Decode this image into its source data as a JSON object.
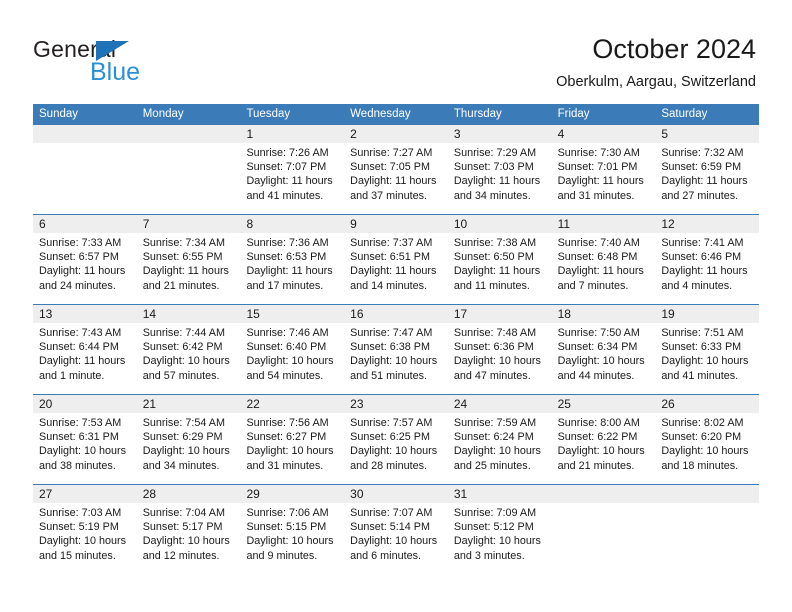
{
  "logo": {
    "text_primary": "General",
    "text_secondary": "Blue",
    "triangle_icon": "triangle-icon",
    "color_primary": "#231f20",
    "color_secondary": "#2b8fd6",
    "color_triangle": "#1e72b8"
  },
  "header": {
    "title": "October 2024",
    "subtitle": "Oberkulm, Aargau, Switzerland"
  },
  "theme": {
    "header_row_bg": "#3b7cb8",
    "date_band_bg": "#eeeeee",
    "separator": "#3b7cb8",
    "text": "#1a1a1a"
  },
  "weekdays": [
    "Sunday",
    "Monday",
    "Tuesday",
    "Wednesday",
    "Thursday",
    "Friday",
    "Saturday"
  ],
  "weeks": [
    {
      "days": [
        {
          "date": "",
          "sunrise": "",
          "sunset": "",
          "daylight_line1": "",
          "daylight_line2": "",
          "empty": true
        },
        {
          "date": "",
          "sunrise": "",
          "sunset": "",
          "daylight_line1": "",
          "daylight_line2": "",
          "empty": true
        },
        {
          "date": "1",
          "sunrise": "Sunrise: 7:26 AM",
          "sunset": "Sunset: 7:07 PM",
          "daylight_line1": "Daylight: 11 hours",
          "daylight_line2": "and 41 minutes."
        },
        {
          "date": "2",
          "sunrise": "Sunrise: 7:27 AM",
          "sunset": "Sunset: 7:05 PM",
          "daylight_line1": "Daylight: 11 hours",
          "daylight_line2": "and 37 minutes."
        },
        {
          "date": "3",
          "sunrise": "Sunrise: 7:29 AM",
          "sunset": "Sunset: 7:03 PM",
          "daylight_line1": "Daylight: 11 hours",
          "daylight_line2": "and 34 minutes."
        },
        {
          "date": "4",
          "sunrise": "Sunrise: 7:30 AM",
          "sunset": "Sunset: 7:01 PM",
          "daylight_line1": "Daylight: 11 hours",
          "daylight_line2": "and 31 minutes."
        },
        {
          "date": "5",
          "sunrise": "Sunrise: 7:32 AM",
          "sunset": "Sunset: 6:59 PM",
          "daylight_line1": "Daylight: 11 hours",
          "daylight_line2": "and 27 minutes."
        }
      ]
    },
    {
      "days": [
        {
          "date": "6",
          "sunrise": "Sunrise: 7:33 AM",
          "sunset": "Sunset: 6:57 PM",
          "daylight_line1": "Daylight: 11 hours",
          "daylight_line2": "and 24 minutes."
        },
        {
          "date": "7",
          "sunrise": "Sunrise: 7:34 AM",
          "sunset": "Sunset: 6:55 PM",
          "daylight_line1": "Daylight: 11 hours",
          "daylight_line2": "and 21 minutes."
        },
        {
          "date": "8",
          "sunrise": "Sunrise: 7:36 AM",
          "sunset": "Sunset: 6:53 PM",
          "daylight_line1": "Daylight: 11 hours",
          "daylight_line2": "and 17 minutes."
        },
        {
          "date": "9",
          "sunrise": "Sunrise: 7:37 AM",
          "sunset": "Sunset: 6:51 PM",
          "daylight_line1": "Daylight: 11 hours",
          "daylight_line2": "and 14 minutes."
        },
        {
          "date": "10",
          "sunrise": "Sunrise: 7:38 AM",
          "sunset": "Sunset: 6:50 PM",
          "daylight_line1": "Daylight: 11 hours",
          "daylight_line2": "and 11 minutes."
        },
        {
          "date": "11",
          "sunrise": "Sunrise: 7:40 AM",
          "sunset": "Sunset: 6:48 PM",
          "daylight_line1": "Daylight: 11 hours",
          "daylight_line2": "and 7 minutes."
        },
        {
          "date": "12",
          "sunrise": "Sunrise: 7:41 AM",
          "sunset": "Sunset: 6:46 PM",
          "daylight_line1": "Daylight: 11 hours",
          "daylight_line2": "and 4 minutes."
        }
      ]
    },
    {
      "days": [
        {
          "date": "13",
          "sunrise": "Sunrise: 7:43 AM",
          "sunset": "Sunset: 6:44 PM",
          "daylight_line1": "Daylight: 11 hours",
          "daylight_line2": "and 1 minute."
        },
        {
          "date": "14",
          "sunrise": "Sunrise: 7:44 AM",
          "sunset": "Sunset: 6:42 PM",
          "daylight_line1": "Daylight: 10 hours",
          "daylight_line2": "and 57 minutes."
        },
        {
          "date": "15",
          "sunrise": "Sunrise: 7:46 AM",
          "sunset": "Sunset: 6:40 PM",
          "daylight_line1": "Daylight: 10 hours",
          "daylight_line2": "and 54 minutes."
        },
        {
          "date": "16",
          "sunrise": "Sunrise: 7:47 AM",
          "sunset": "Sunset: 6:38 PM",
          "daylight_line1": "Daylight: 10 hours",
          "daylight_line2": "and 51 minutes."
        },
        {
          "date": "17",
          "sunrise": "Sunrise: 7:48 AM",
          "sunset": "Sunset: 6:36 PM",
          "daylight_line1": "Daylight: 10 hours",
          "daylight_line2": "and 47 minutes."
        },
        {
          "date": "18",
          "sunrise": "Sunrise: 7:50 AM",
          "sunset": "Sunset: 6:34 PM",
          "daylight_line1": "Daylight: 10 hours",
          "daylight_line2": "and 44 minutes."
        },
        {
          "date": "19",
          "sunrise": "Sunrise: 7:51 AM",
          "sunset": "Sunset: 6:33 PM",
          "daylight_line1": "Daylight: 10 hours",
          "daylight_line2": "and 41 minutes."
        }
      ]
    },
    {
      "days": [
        {
          "date": "20",
          "sunrise": "Sunrise: 7:53 AM",
          "sunset": "Sunset: 6:31 PM",
          "daylight_line1": "Daylight: 10 hours",
          "daylight_line2": "and 38 minutes."
        },
        {
          "date": "21",
          "sunrise": "Sunrise: 7:54 AM",
          "sunset": "Sunset: 6:29 PM",
          "daylight_line1": "Daylight: 10 hours",
          "daylight_line2": "and 34 minutes."
        },
        {
          "date": "22",
          "sunrise": "Sunrise: 7:56 AM",
          "sunset": "Sunset: 6:27 PM",
          "daylight_line1": "Daylight: 10 hours",
          "daylight_line2": "and 31 minutes."
        },
        {
          "date": "23",
          "sunrise": "Sunrise: 7:57 AM",
          "sunset": "Sunset: 6:25 PM",
          "daylight_line1": "Daylight: 10 hours",
          "daylight_line2": "and 28 minutes."
        },
        {
          "date": "24",
          "sunrise": "Sunrise: 7:59 AM",
          "sunset": "Sunset: 6:24 PM",
          "daylight_line1": "Daylight: 10 hours",
          "daylight_line2": "and 25 minutes."
        },
        {
          "date": "25",
          "sunrise": "Sunrise: 8:00 AM",
          "sunset": "Sunset: 6:22 PM",
          "daylight_line1": "Daylight: 10 hours",
          "daylight_line2": "and 21 minutes."
        },
        {
          "date": "26",
          "sunrise": "Sunrise: 8:02 AM",
          "sunset": "Sunset: 6:20 PM",
          "daylight_line1": "Daylight: 10 hours",
          "daylight_line2": "and 18 minutes."
        }
      ]
    },
    {
      "days": [
        {
          "date": "27",
          "sunrise": "Sunrise: 7:03 AM",
          "sunset": "Sunset: 5:19 PM",
          "daylight_line1": "Daylight: 10 hours",
          "daylight_line2": "and 15 minutes."
        },
        {
          "date": "28",
          "sunrise": "Sunrise: 7:04 AM",
          "sunset": "Sunset: 5:17 PM",
          "daylight_line1": "Daylight: 10 hours",
          "daylight_line2": "and 12 minutes."
        },
        {
          "date": "29",
          "sunrise": "Sunrise: 7:06 AM",
          "sunset": "Sunset: 5:15 PM",
          "daylight_line1": "Daylight: 10 hours",
          "daylight_line2": "and 9 minutes."
        },
        {
          "date": "30",
          "sunrise": "Sunrise: 7:07 AM",
          "sunset": "Sunset: 5:14 PM",
          "daylight_line1": "Daylight: 10 hours",
          "daylight_line2": "and 6 minutes."
        },
        {
          "date": "31",
          "sunrise": "Sunrise: 7:09 AM",
          "sunset": "Sunset: 5:12 PM",
          "daylight_line1": "Daylight: 10 hours",
          "daylight_line2": "and 3 minutes."
        },
        {
          "date": "",
          "sunrise": "",
          "sunset": "",
          "daylight_line1": "",
          "daylight_line2": "",
          "empty": true
        },
        {
          "date": "",
          "sunrise": "",
          "sunset": "",
          "daylight_line1": "",
          "daylight_line2": "",
          "empty": true
        }
      ]
    }
  ]
}
